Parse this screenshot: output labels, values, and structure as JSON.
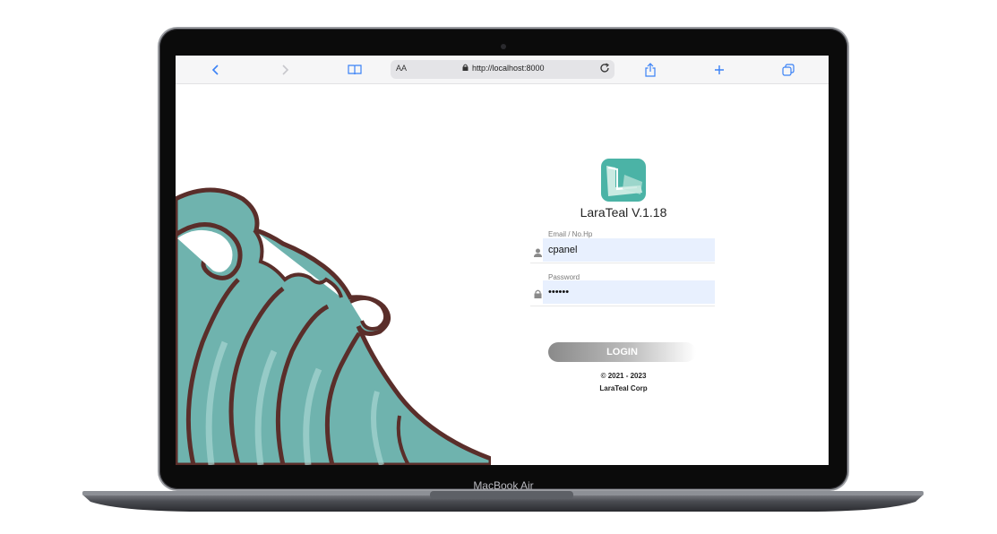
{
  "browser": {
    "text_size_label": "AA",
    "url": "http://localhost:8000",
    "icons": [
      "back-icon",
      "forward-icon",
      "book-icon",
      "lock-icon",
      "reload-icon",
      "share-icon",
      "add-tab-icon",
      "tabs-icon"
    ]
  },
  "login": {
    "app_title": "LaraTeal V.1.18",
    "email_label": "Email / No.Hp",
    "email_value": "cpanel",
    "password_label": "Password",
    "password_value": "••••••",
    "login_button": "LOGIN",
    "copyright": "© 2021 - 2023",
    "company": "LaraTeal Corp"
  },
  "device": {
    "label": "MacBook Air"
  },
  "colors": {
    "teal": "#4bb3a6",
    "wave_outline": "#5a2e2a",
    "input_bg": "#e8f0fe"
  }
}
